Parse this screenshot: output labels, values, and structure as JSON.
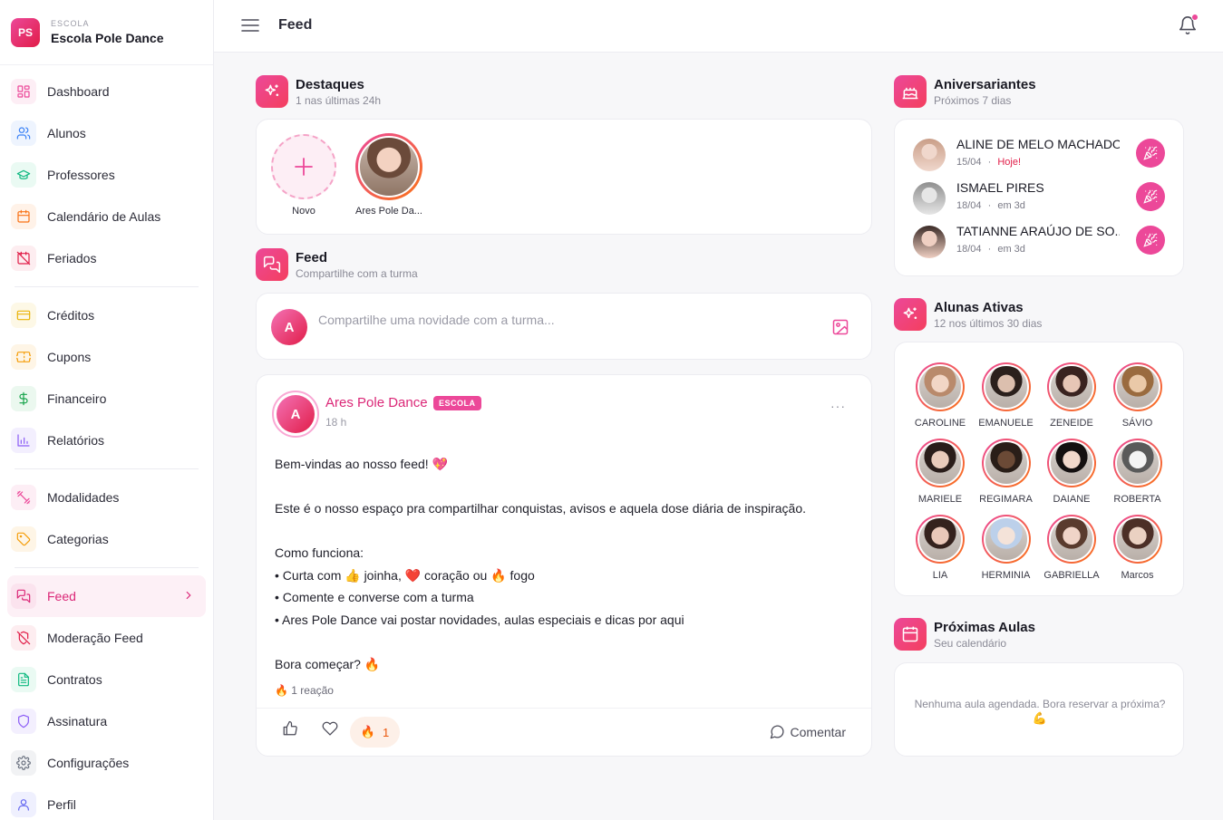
{
  "brand": {
    "logo": "PS",
    "kicker": "ESCOLA",
    "name": "Escola Pole Dance"
  },
  "nav": {
    "group1": [
      {
        "label": "Dashboard",
        "icon": "dashboard-icon",
        "color": "#ec4899",
        "bg": "#fdeef5"
      },
      {
        "label": "Alunos",
        "icon": "users-icon",
        "color": "#3b82f6",
        "bg": "#eef4fe"
      },
      {
        "label": "Professores",
        "icon": "graduation-cap-icon",
        "color": "#10b981",
        "bg": "#eafaf3"
      },
      {
        "label": "Calendário de Aulas",
        "icon": "calendar-icon",
        "color": "#f97316",
        "bg": "#fff2e8"
      },
      {
        "label": "Feriados",
        "icon": "calendar-off-icon",
        "color": "#e11d48",
        "bg": "#fdedf0"
      }
    ],
    "group2": [
      {
        "label": "Créditos",
        "icon": "credit-card-icon",
        "color": "#eab308",
        "bg": "#fdf8e6"
      },
      {
        "label": "Cupons",
        "icon": "ticket-icon",
        "color": "#f59e0b",
        "bg": "#fef5e6"
      },
      {
        "label": "Financeiro",
        "icon": "dollar-icon",
        "color": "#16a34a",
        "bg": "#ebf8ef"
      },
      {
        "label": "Relatórios",
        "icon": "bar-chart-icon",
        "color": "#8b5cf6",
        "bg": "#f3effe"
      }
    ],
    "group3": [
      {
        "label": "Modalidades",
        "icon": "dumbbell-icon",
        "color": "#ec4899",
        "bg": "#fdeef5"
      },
      {
        "label": "Categorias",
        "icon": "tag-icon",
        "color": "#f59e0b",
        "bg": "#fef5e6"
      }
    ],
    "group4": [
      {
        "label": "Feed",
        "icon": "chat-icon",
        "color": "#db2777",
        "bg": "#fbe3ee",
        "active": true
      },
      {
        "label": "Moderação Feed",
        "icon": "shield-off-icon",
        "color": "#e11d48",
        "bg": "#fdedf0"
      },
      {
        "label": "Contratos",
        "icon": "file-text-icon",
        "color": "#10b981",
        "bg": "#eafaf3"
      },
      {
        "label": "Assinatura",
        "icon": "shield-icon",
        "color": "#8b5cf6",
        "bg": "#f3effe"
      },
      {
        "label": "Configurações",
        "icon": "gear-icon",
        "color": "#6b7280",
        "bg": "#f1f2f4"
      },
      {
        "label": "Perfil",
        "icon": "user-icon",
        "color": "#6366f1",
        "bg": "#eff0fe"
      }
    ]
  },
  "topbar": {
    "title": "Feed"
  },
  "highlights": {
    "title": "Destaques",
    "subtitle": "1 nas últimas 24h",
    "new_label": "Novo",
    "story_label": "Ares Pole Da..."
  },
  "feed": {
    "title": "Feed",
    "subtitle": "Compartilhe com a turma"
  },
  "composer": {
    "avatar_letter": "A",
    "placeholder": "Compartilhe uma novidade com a turma..."
  },
  "post": {
    "avatar_letter": "A",
    "author": "Ares Pole Dance",
    "badge": "ESCOLA",
    "time": "18 h",
    "menu": "···",
    "lines": {
      "l1": "Bem-vindas ao nosso feed! 💖",
      "l2": "Este é o nosso espaço pra compartilhar conquistas, avisos e aquela dose diária de inspiração.",
      "l3": "Como funciona:",
      "l4": "• Curta com 👍 joinha, ❤️ coração ou 🔥 fogo",
      "l5": "• Comente e converse com a turma",
      "l6": "• Ares Pole Dance vai postar novidades, aulas especiais e dicas por aqui",
      "l7": "Bora começar? 🔥"
    },
    "reactions_summary": "🔥 1 reação",
    "fire_emoji": "🔥",
    "fire_count": "1",
    "comment_label": "Comentar"
  },
  "birthdays": {
    "title": "Aniversariantes",
    "subtitle": "Próximos 7 dias",
    "items": [
      {
        "name": "ALINE DE MELO MACHADO",
        "date": "15/04",
        "sep": "·",
        "when": "Hoje!",
        "today": true
      },
      {
        "name": "ISMAEL PIRES",
        "date": "18/04",
        "sep": "·",
        "when": "em 3d",
        "today": false
      },
      {
        "name": "TATIANNE ARAÚJO DE SO...",
        "date": "18/04",
        "sep": "·",
        "when": "em 3d",
        "today": false
      }
    ]
  },
  "active_students": {
    "title": "Alunas Ativas",
    "subtitle": "12 nos últimos 30 dias",
    "names": [
      "CAROLINE",
      "EMANUELE",
      "ZENEIDE",
      "SÁVIO",
      "MARIELE",
      "REGIMARA",
      "DAIANE",
      "ROBERTA",
      "LIA",
      "HERMINIA",
      "GABRIELLA",
      "Marcos"
    ]
  },
  "next_classes": {
    "title": "Próximas Aulas",
    "subtitle": "Seu calendário",
    "empty": "Nenhuma aula agendada. Bora reservar a próxima?",
    "empty_emoji": "💪"
  }
}
